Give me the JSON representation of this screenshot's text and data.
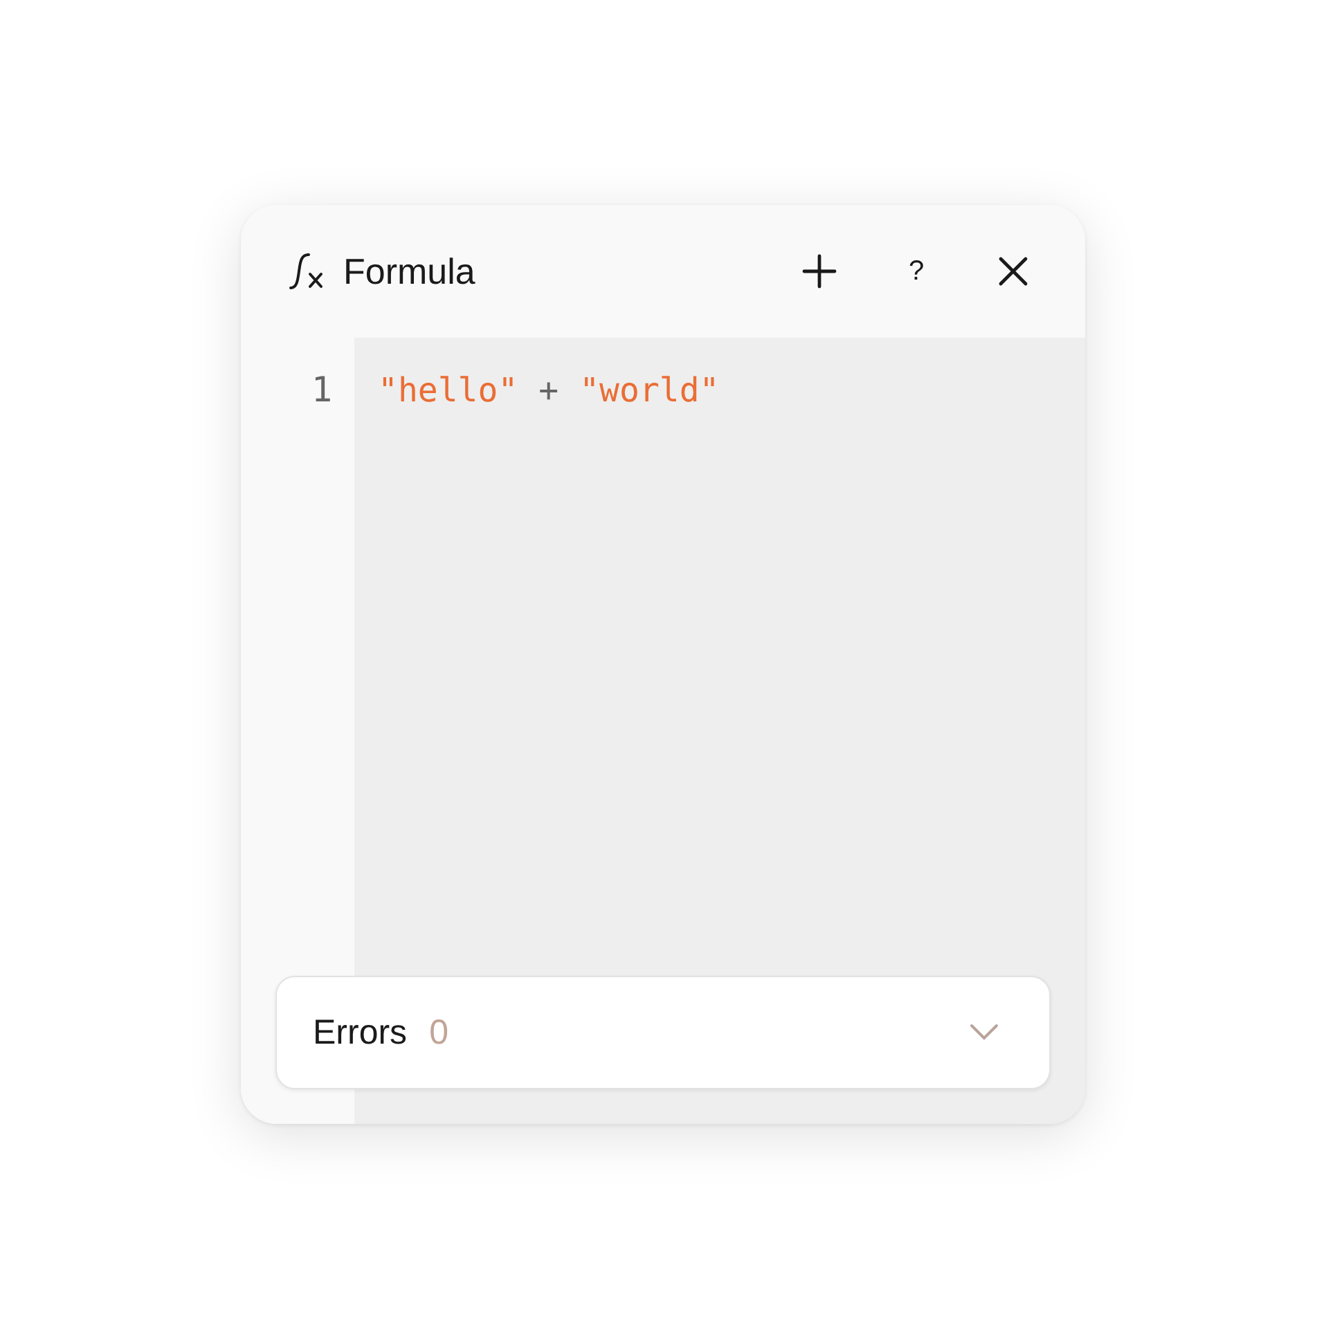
{
  "panel": {
    "title": "Formula",
    "help": "?"
  },
  "editor": {
    "lines": [
      {
        "number": "1",
        "tokens": [
          {
            "kind": "string",
            "text": "\"hello\""
          },
          {
            "kind": "operator",
            "text": "+"
          },
          {
            "kind": "string",
            "text": "\"world\""
          }
        ]
      }
    ]
  },
  "errors": {
    "label": "Errors",
    "count": "0",
    "expanded": false
  }
}
